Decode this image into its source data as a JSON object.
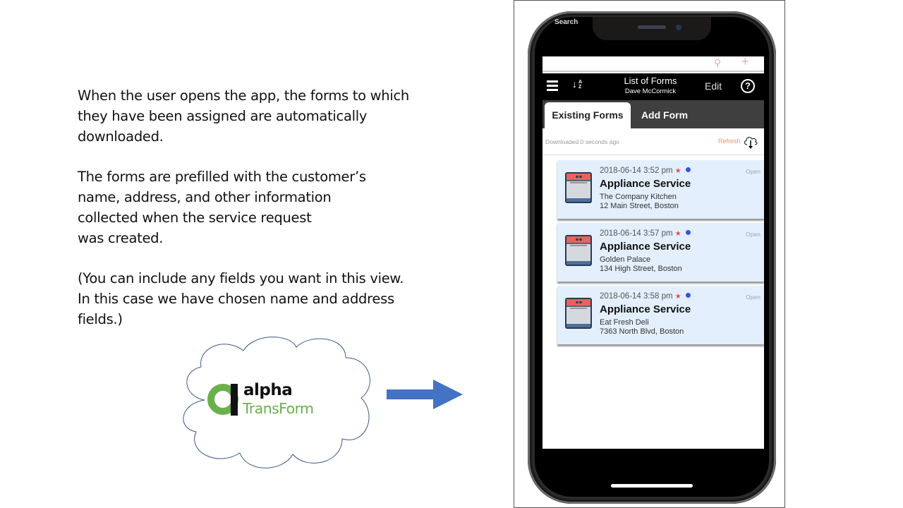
{
  "slide": {
    "paragraphs": [
      "When the user opens the app, the forms to which\nthey have been assigned are automatically\ndownloaded.",
      "The forms are prefilled with the customer’s\nname, address, and other information\ncollected when the service request\nwas created.",
      "(You can include any fields you want in this view.\nIn this case we have chosen name and address\nfields.)"
    ],
    "logo": {
      "word1": "alpha",
      "word2": "TransForm",
      "brand_green": "#6ab04c"
    },
    "arrow_color": "#4472c4"
  },
  "phone": {
    "status_text": "Search",
    "search_icon": "search-icon",
    "add_icon": "plus-icon",
    "header": {
      "title": "List of Forms",
      "subtitle": "Dave McCormick",
      "menu_icon": "hamburger-icon",
      "sort_icon": "sort-az-icon",
      "sort_glyph": "↓",
      "sort_letters": "A\nZ",
      "edit_label": "Edit",
      "help_glyph": "?"
    },
    "tabs": [
      {
        "label": "Existing Forms",
        "active": true
      },
      {
        "label": "Add Form",
        "active": false
      }
    ],
    "download_status": "Downloaded 0 seconds ago",
    "refresh_label": "Refresh",
    "accent_orange": "#e8956a",
    "forms": [
      {
        "datetime": "2018-06-14 3:52 pm",
        "star": "★",
        "status": "Open",
        "title": "Appliance Service",
        "customer": "The Company Kitchen",
        "address": "12 Main Street, Boston"
      },
      {
        "datetime": "2018-06-14 3:57 pm",
        "star": "★",
        "status": "Open",
        "title": "Appliance Service",
        "customer": "Golden Palace",
        "address": "134 High Street, Boston"
      },
      {
        "datetime": "2018-06-14 3:58 pm",
        "star": "★",
        "status": "Open",
        "title": "Appliance Service",
        "customer": "Eat Fresh Deli",
        "address": "7363 North Blvd, Boston"
      }
    ]
  }
}
